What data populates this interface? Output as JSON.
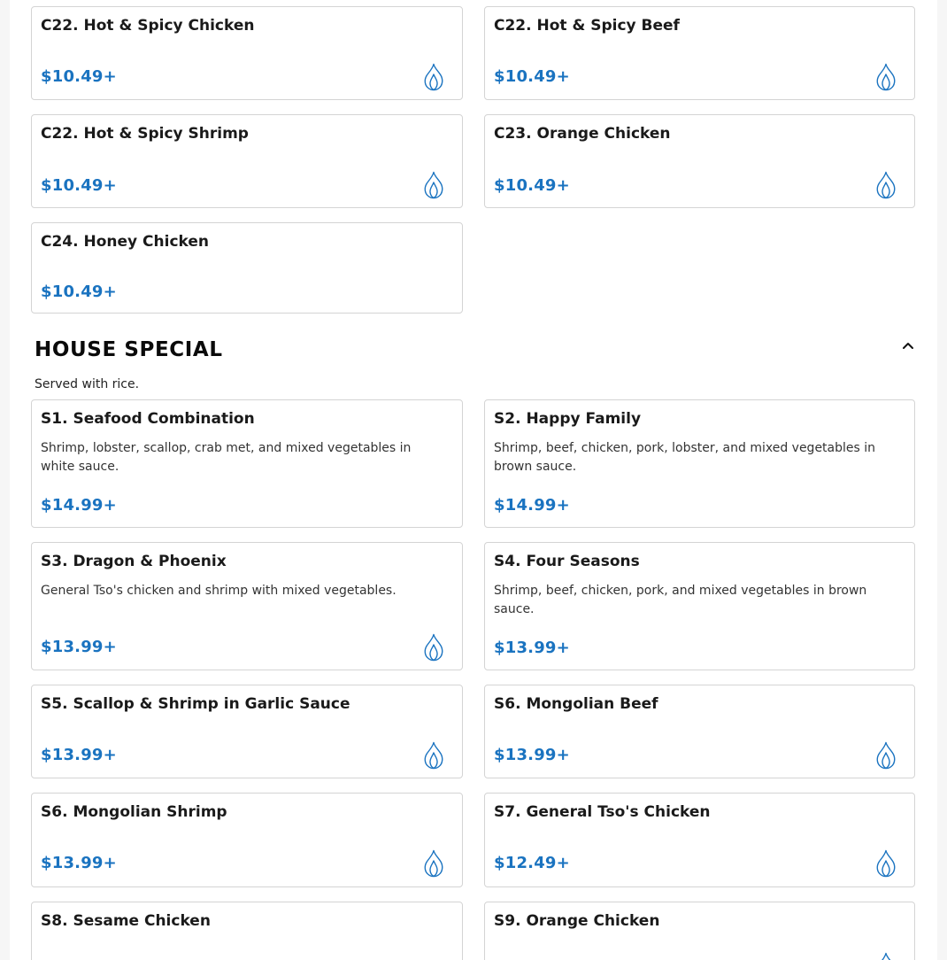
{
  "top_items": [
    {
      "title": "C22. Hot & Spicy Chicken",
      "price": "$10.49+",
      "icon": "flame-icon"
    },
    {
      "title": "C22. Hot & Spicy Beef",
      "price": "$10.49+",
      "icon": "flame-icon"
    },
    {
      "title": "C22. Hot & Spicy Shrimp",
      "price": "$10.49+",
      "icon": "flame-icon"
    },
    {
      "title": "C23. Orange Chicken",
      "price": "$10.49+",
      "icon": "flame-icon"
    },
    {
      "title": "C24. Honey Chicken",
      "price": "$10.49+"
    }
  ],
  "house_special": {
    "title": "HOUSE SPECIAL",
    "subtitle": "Served with rice.",
    "collapse_icon": "chevron-up-icon",
    "items": [
      {
        "title": "S1. Seafood Combination",
        "desc": "Shrimp, lobster, scallop, crab met, and mixed vegetables in white sauce.",
        "price": "$14.99+"
      },
      {
        "title": "S2. Happy Family",
        "desc": "Shrimp, beef, chicken, pork, lobster, and mixed vegetables in brown sauce.",
        "price": "$14.99+"
      },
      {
        "title": "S3. Dragon & Phoenix",
        "desc": "General Tso's chicken and shrimp with mixed vegetables.",
        "price": "$13.99+",
        "icon": "flame-icon"
      },
      {
        "title": "S4. Four Seasons",
        "desc": "Shrimp, beef, chicken, pork, and mixed vegetables in brown sauce.",
        "price": "$13.99+"
      },
      {
        "title": "S5. Scallop & Shrimp in Garlic Sauce",
        "price": "$13.99+",
        "icon": "flame-icon"
      },
      {
        "title": "S6. Mongolian Beef",
        "price": "$13.99+",
        "icon": "flame-icon"
      },
      {
        "title": "S6. Mongolian Shrimp",
        "price": "$13.99+",
        "icon": "flame-icon"
      },
      {
        "title": "S7. General Tso's Chicken",
        "price": "$12.49+",
        "icon": "flame-icon"
      },
      {
        "title": "S8. Sesame Chicken"
      },
      {
        "title": "S9. Orange Chicken",
        "icon": "flame-icon"
      }
    ]
  },
  "colors": {
    "price": "#1a73c0",
    "border": "#d4d4d4",
    "flame": "#1a73c0"
  }
}
